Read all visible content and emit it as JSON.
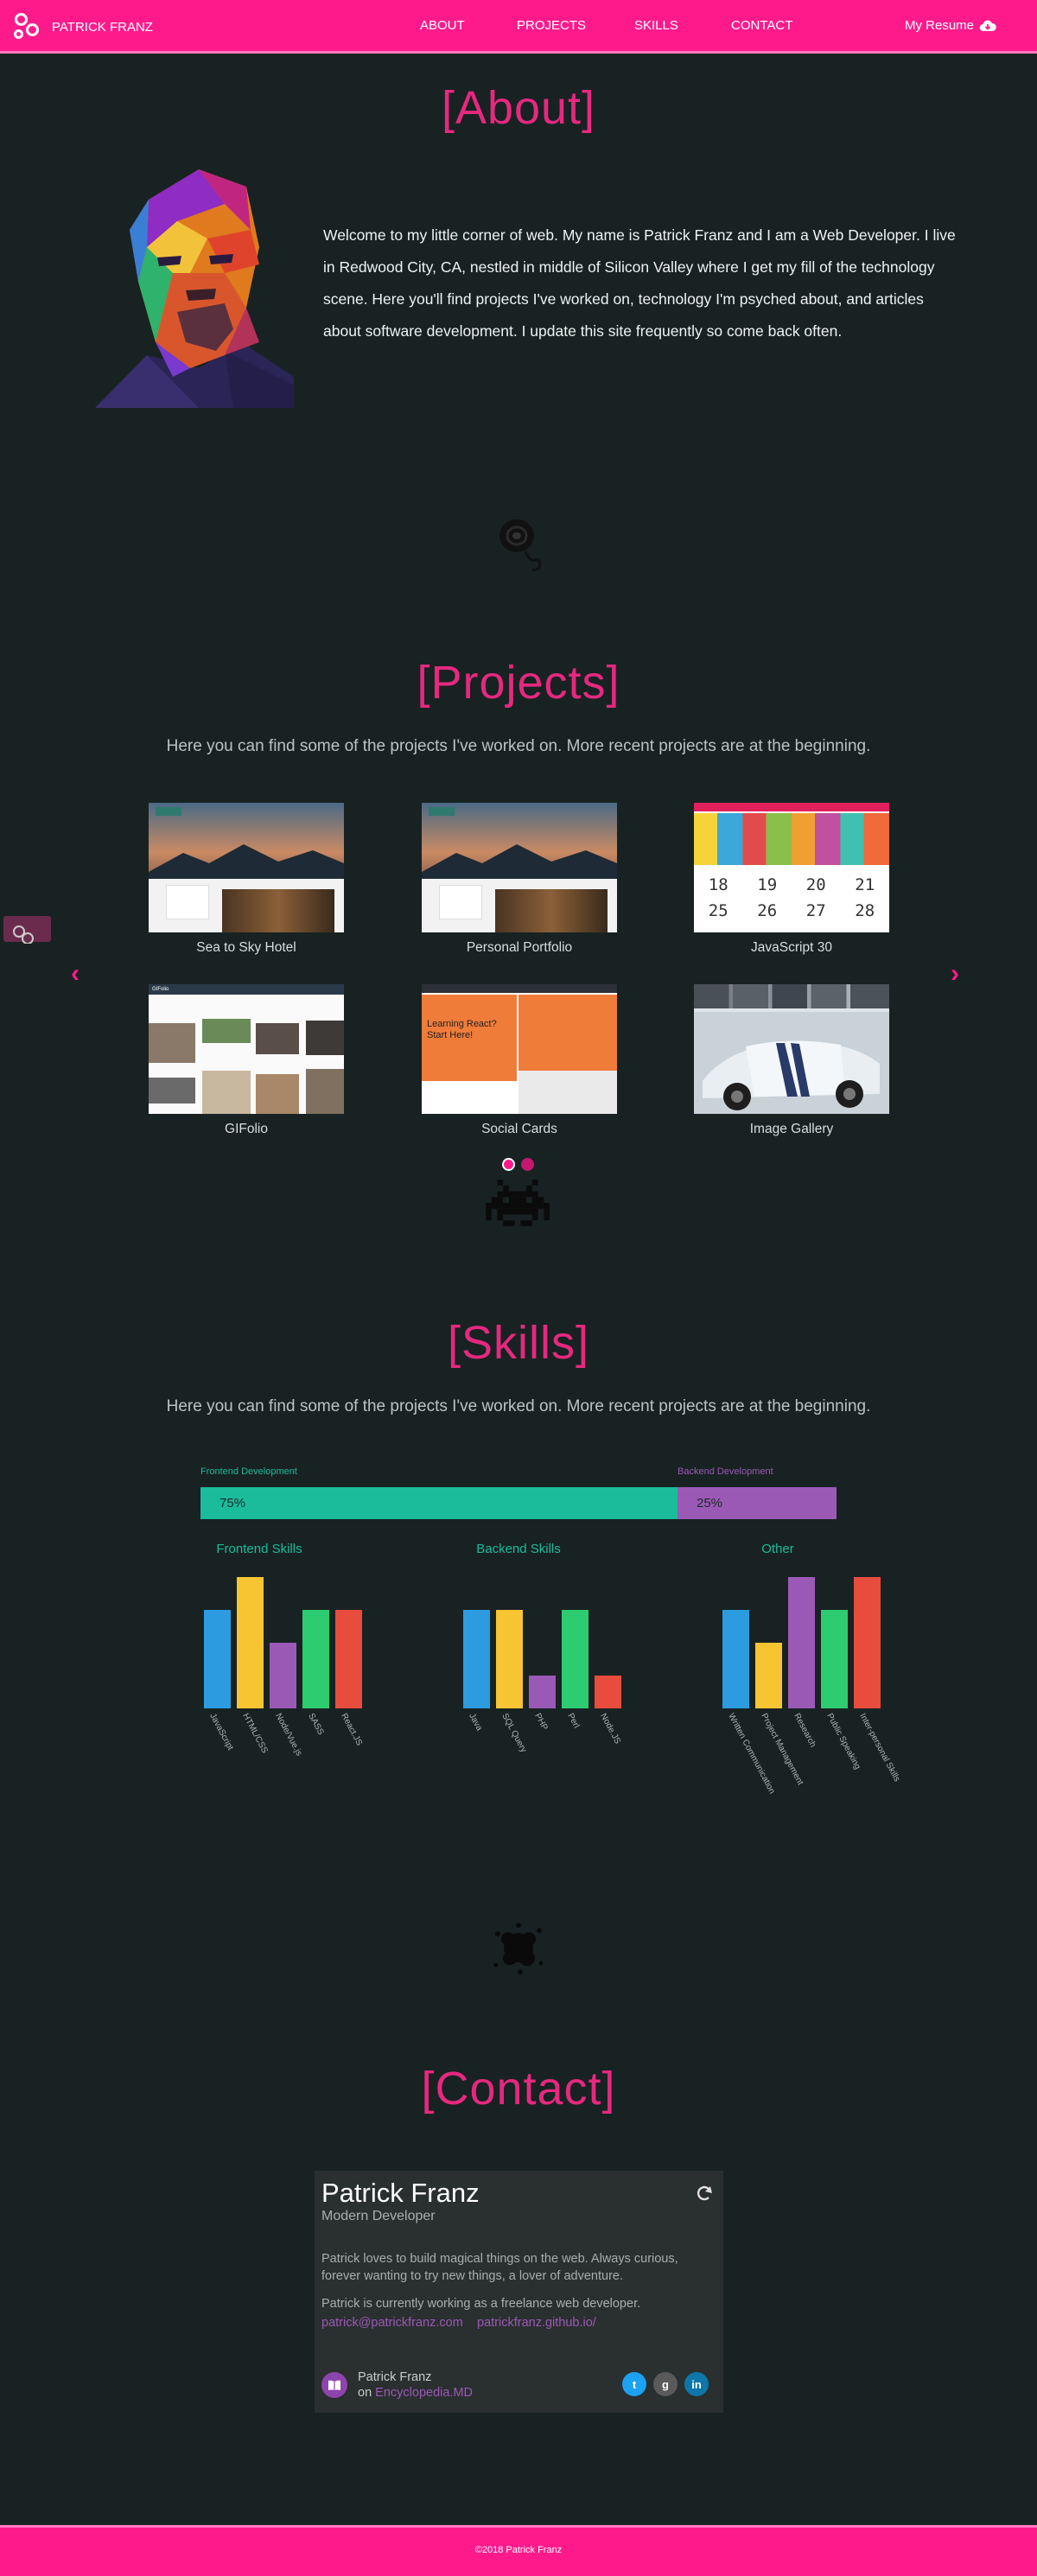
{
  "nav": {
    "brand": "PATRICK FRANZ",
    "links": [
      "ABOUT",
      "PROJECTS",
      "SKILLS",
      "CONTACT"
    ],
    "resume": "My Resume",
    "resume_icon": "cloud-download-icon"
  },
  "about": {
    "heading": "[About]",
    "text": "Welcome to my little corner of web. My name is Patrick Franz and I am a Web Developer. I live in Redwood City, CA, nestled in middle of Silicon Valley where I get my fill of the technology scene. Here you'll find projects I've worked on, technology I'm psyched about, and articles about software development. I update this site frequently so come back often."
  },
  "projects": {
    "heading": "[Projects]",
    "subtext": "Here you can find some of the projects I've worked on. More recent projects are at the beginning.",
    "items": [
      {
        "label": "Sea to Sky Hotel"
      },
      {
        "label": "Personal Portfolio"
      },
      {
        "label": "JavaScript 30"
      },
      {
        "label": "GIFolio"
      },
      {
        "label": "Social Cards"
      },
      {
        "label": "Image Gallery"
      }
    ],
    "thumb_texts": {
      "calendar": [
        "18",
        "19",
        "20",
        "21",
        "25",
        "26",
        "27",
        "28"
      ],
      "social_card_title": "Learning React? Start Here!",
      "gifolio_header": "GIFolio"
    },
    "active_page": 1,
    "page_count": 2
  },
  "skills": {
    "heading": "[Skills]",
    "subtext": "Here you can find some of the projects I've worked on. More recent projects are at the beginning.",
    "split": {
      "left_label": "Frontend Development",
      "right_label": "Backend Development",
      "left_value": "75%",
      "right_value": "25%",
      "left_fraction": 0.75,
      "left_color": "#1abc9c",
      "right_color": "#9b59b6"
    },
    "columns": [
      {
        "title": "Frontend Skills",
        "bars": [
          {
            "label": "JavaScript",
            "value": 3,
            "color": "#2c9be0"
          },
          {
            "label": "HTML/CSS",
            "value": 4,
            "color": "#f7c531"
          },
          {
            "label": "Node/Vue.js",
            "value": 2,
            "color": "#9b59b6"
          },
          {
            "label": "SASS",
            "value": 3,
            "color": "#2ecc71"
          },
          {
            "label": "React.JS",
            "value": 3,
            "color": "#e74c3c"
          }
        ]
      },
      {
        "title": "Backend Skills",
        "bars": [
          {
            "label": "Java",
            "value": 3,
            "color": "#2c9be0"
          },
          {
            "label": "SQL Query",
            "value": 3,
            "color": "#f7c531"
          },
          {
            "label": "PHP",
            "value": 1,
            "color": "#9b59b6"
          },
          {
            "label": "Perl",
            "value": 3,
            "color": "#2ecc71"
          },
          {
            "label": "Node.JS",
            "value": 1,
            "color": "#e74c3c"
          }
        ]
      },
      {
        "title": "Other",
        "bars": [
          {
            "label": "Written Communication",
            "value": 3,
            "color": "#2c9be0"
          },
          {
            "label": "Project Management",
            "value": 2,
            "color": "#f7c531"
          },
          {
            "label": "Research",
            "value": 4,
            "color": "#9b59b6"
          },
          {
            "label": "Public Speaking",
            "value": 3,
            "color": "#2ecc71"
          },
          {
            "label": "Inter-personal Skills",
            "value": 4,
            "color": "#e74c3c"
          }
        ]
      }
    ]
  },
  "contact": {
    "heading": "[Contact]",
    "name": "Patrick Franz",
    "role": "Modern Developer",
    "bio": "Patrick loves to build magical things on the web. Always curious, forever wanting to try new things, a lover of adventure.",
    "status": "Patrick is currently working as a freelance web developer.",
    "email": "patrick@patrickfranz.com",
    "site": "patrickfranz.github.io/",
    "footer_name": "Patrick Franz",
    "footer_on": "on",
    "footer_source": "Encyclopedia.MD",
    "social": [
      {
        "icon": "twitter-icon",
        "glyph": "t",
        "color": "#1da1f2"
      },
      {
        "icon": "github-icon",
        "glyph": "g",
        "color": "#5a5a5a"
      },
      {
        "icon": "linkedin-icon",
        "glyph": "in",
        "color": "#0e76a8"
      }
    ]
  },
  "footer": {
    "text": "©2018 Patrick Franz"
  },
  "colors": {
    "accent": "#ff1a8c",
    "heading": "#e6287f",
    "background": "#182222"
  }
}
